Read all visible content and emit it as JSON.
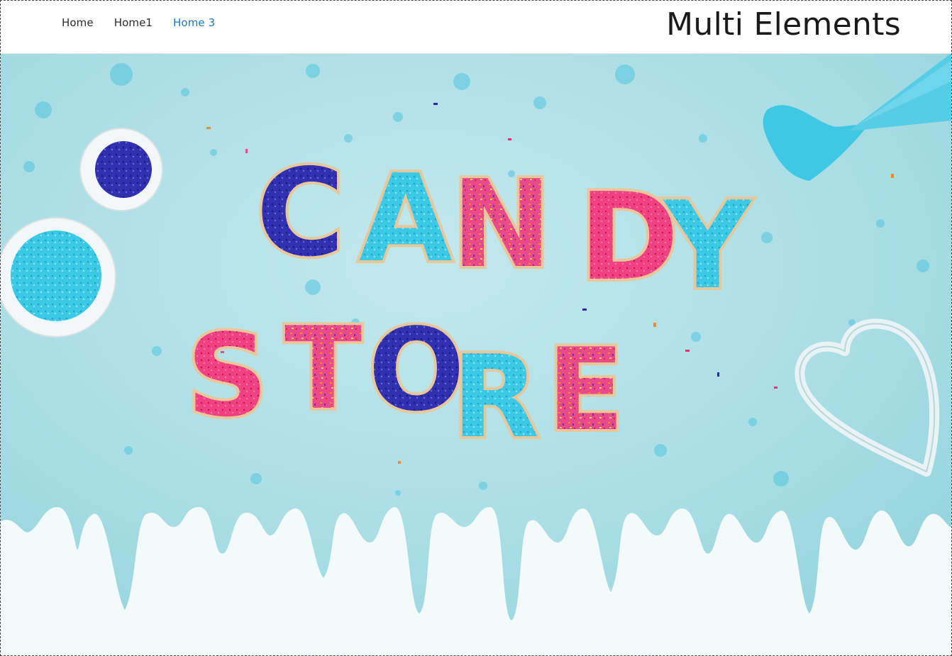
{
  "nav": {
    "items": [
      {
        "label": "Home",
        "active": false
      },
      {
        "label": "Home1",
        "active": false
      },
      {
        "label": "Home 3",
        "active": true
      }
    ]
  },
  "brand": {
    "title": "Multi Elements"
  },
  "hero": {
    "letters_line1": [
      "C",
      "A",
      "N",
      "D",
      "Y"
    ],
    "letters_line2": [
      "S",
      "T",
      "O",
      "R",
      "E"
    ],
    "colors": {
      "background": "#a9dde4",
      "drip": "#f3fafa",
      "pink": "#ec2f74",
      "navy": "#2c2aa2",
      "cyan": "#36c6e4",
      "orange": "#f0892f",
      "nav_active": "#1e7ab8"
    }
  }
}
